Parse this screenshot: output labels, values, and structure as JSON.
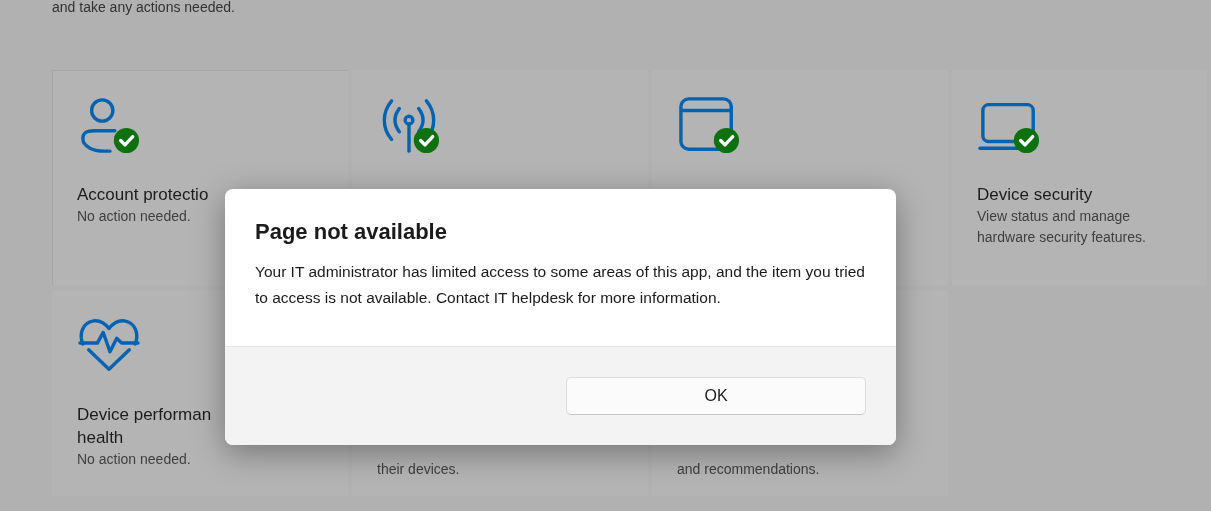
{
  "page": {
    "intro_text": "and take any actions needed."
  },
  "tiles": [
    {
      "kind": "person",
      "healthy": true,
      "focused": true,
      "title_lines": [
        "Account protectio"
      ],
      "description": "No action needed."
    },
    {
      "kind": "antenna",
      "healthy": true,
      "focused": false
    },
    {
      "kind": "browser",
      "healthy": true,
      "focused": false
    },
    {
      "kind": "laptop",
      "healthy": true,
      "focused": false,
      "title_lines": [
        "Device security"
      ],
      "description": "View status and manage hardware security features."
    },
    {
      "kind": "heart",
      "healthy": false,
      "focused": false,
      "title_lines": [
        "Device performan",
        "health"
      ],
      "description": "No action needed."
    },
    {
      "focused": false,
      "description": "their devices."
    },
    {
      "focused": false,
      "description": "and recommendations."
    }
  ],
  "dialog": {
    "title": "Page not available",
    "message": "Your IT administrator has limited access to some areas of this app, and the item you tried to access is not available. Contact IT helpdesk for more information.",
    "buttons": [
      "OK"
    ]
  }
}
